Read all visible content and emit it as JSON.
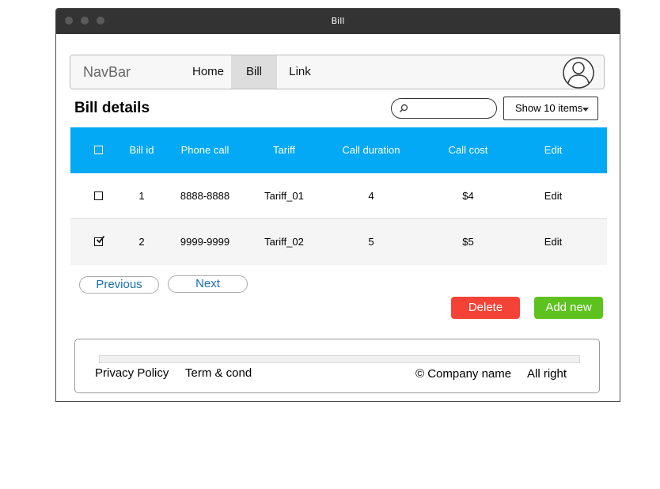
{
  "window": {
    "title": "Bill"
  },
  "navbar": {
    "brand": "NavBar",
    "links": [
      {
        "label": "Home",
        "active": false
      },
      {
        "label": "Bill",
        "active": true
      },
      {
        "label": "Link",
        "active": false
      }
    ],
    "profile_icon": "user-circle-icon"
  },
  "page": {
    "heading": "Bill details",
    "search": {
      "placeholder": "",
      "value": "",
      "icon": "search-icon"
    },
    "show_select": {
      "selected": "Show 10 items"
    }
  },
  "table": {
    "columns": [
      "Bill id",
      "Phone call",
      "Tariff",
      "Call duration",
      "Call cost",
      "Edit"
    ],
    "rows": [
      {
        "checked": false,
        "bill_id": "1",
        "phone_call": "8888-8888",
        "tariff": "Tariff_01",
        "call_duration": "4",
        "call_cost": "$4",
        "edit": "Edit"
      },
      {
        "checked": true,
        "bill_id": "2",
        "phone_call": "9999-9999",
        "tariff": "Tariff_02",
        "call_duration": "5",
        "call_cost": "$5",
        "edit": "Edit"
      }
    ]
  },
  "pagination": {
    "previous": "Previous",
    "next": "Next"
  },
  "actions": {
    "delete": "Delete",
    "add_new": "Add new"
  },
  "colors": {
    "header": "#03a9f4",
    "delete": "#f44336",
    "add_new": "#5dc21e",
    "titlebar": "#333333"
  },
  "footer": {
    "privacy": "Privacy Policy",
    "terms": "Term & cond",
    "company": "© Company name",
    "rights": "All right"
  }
}
